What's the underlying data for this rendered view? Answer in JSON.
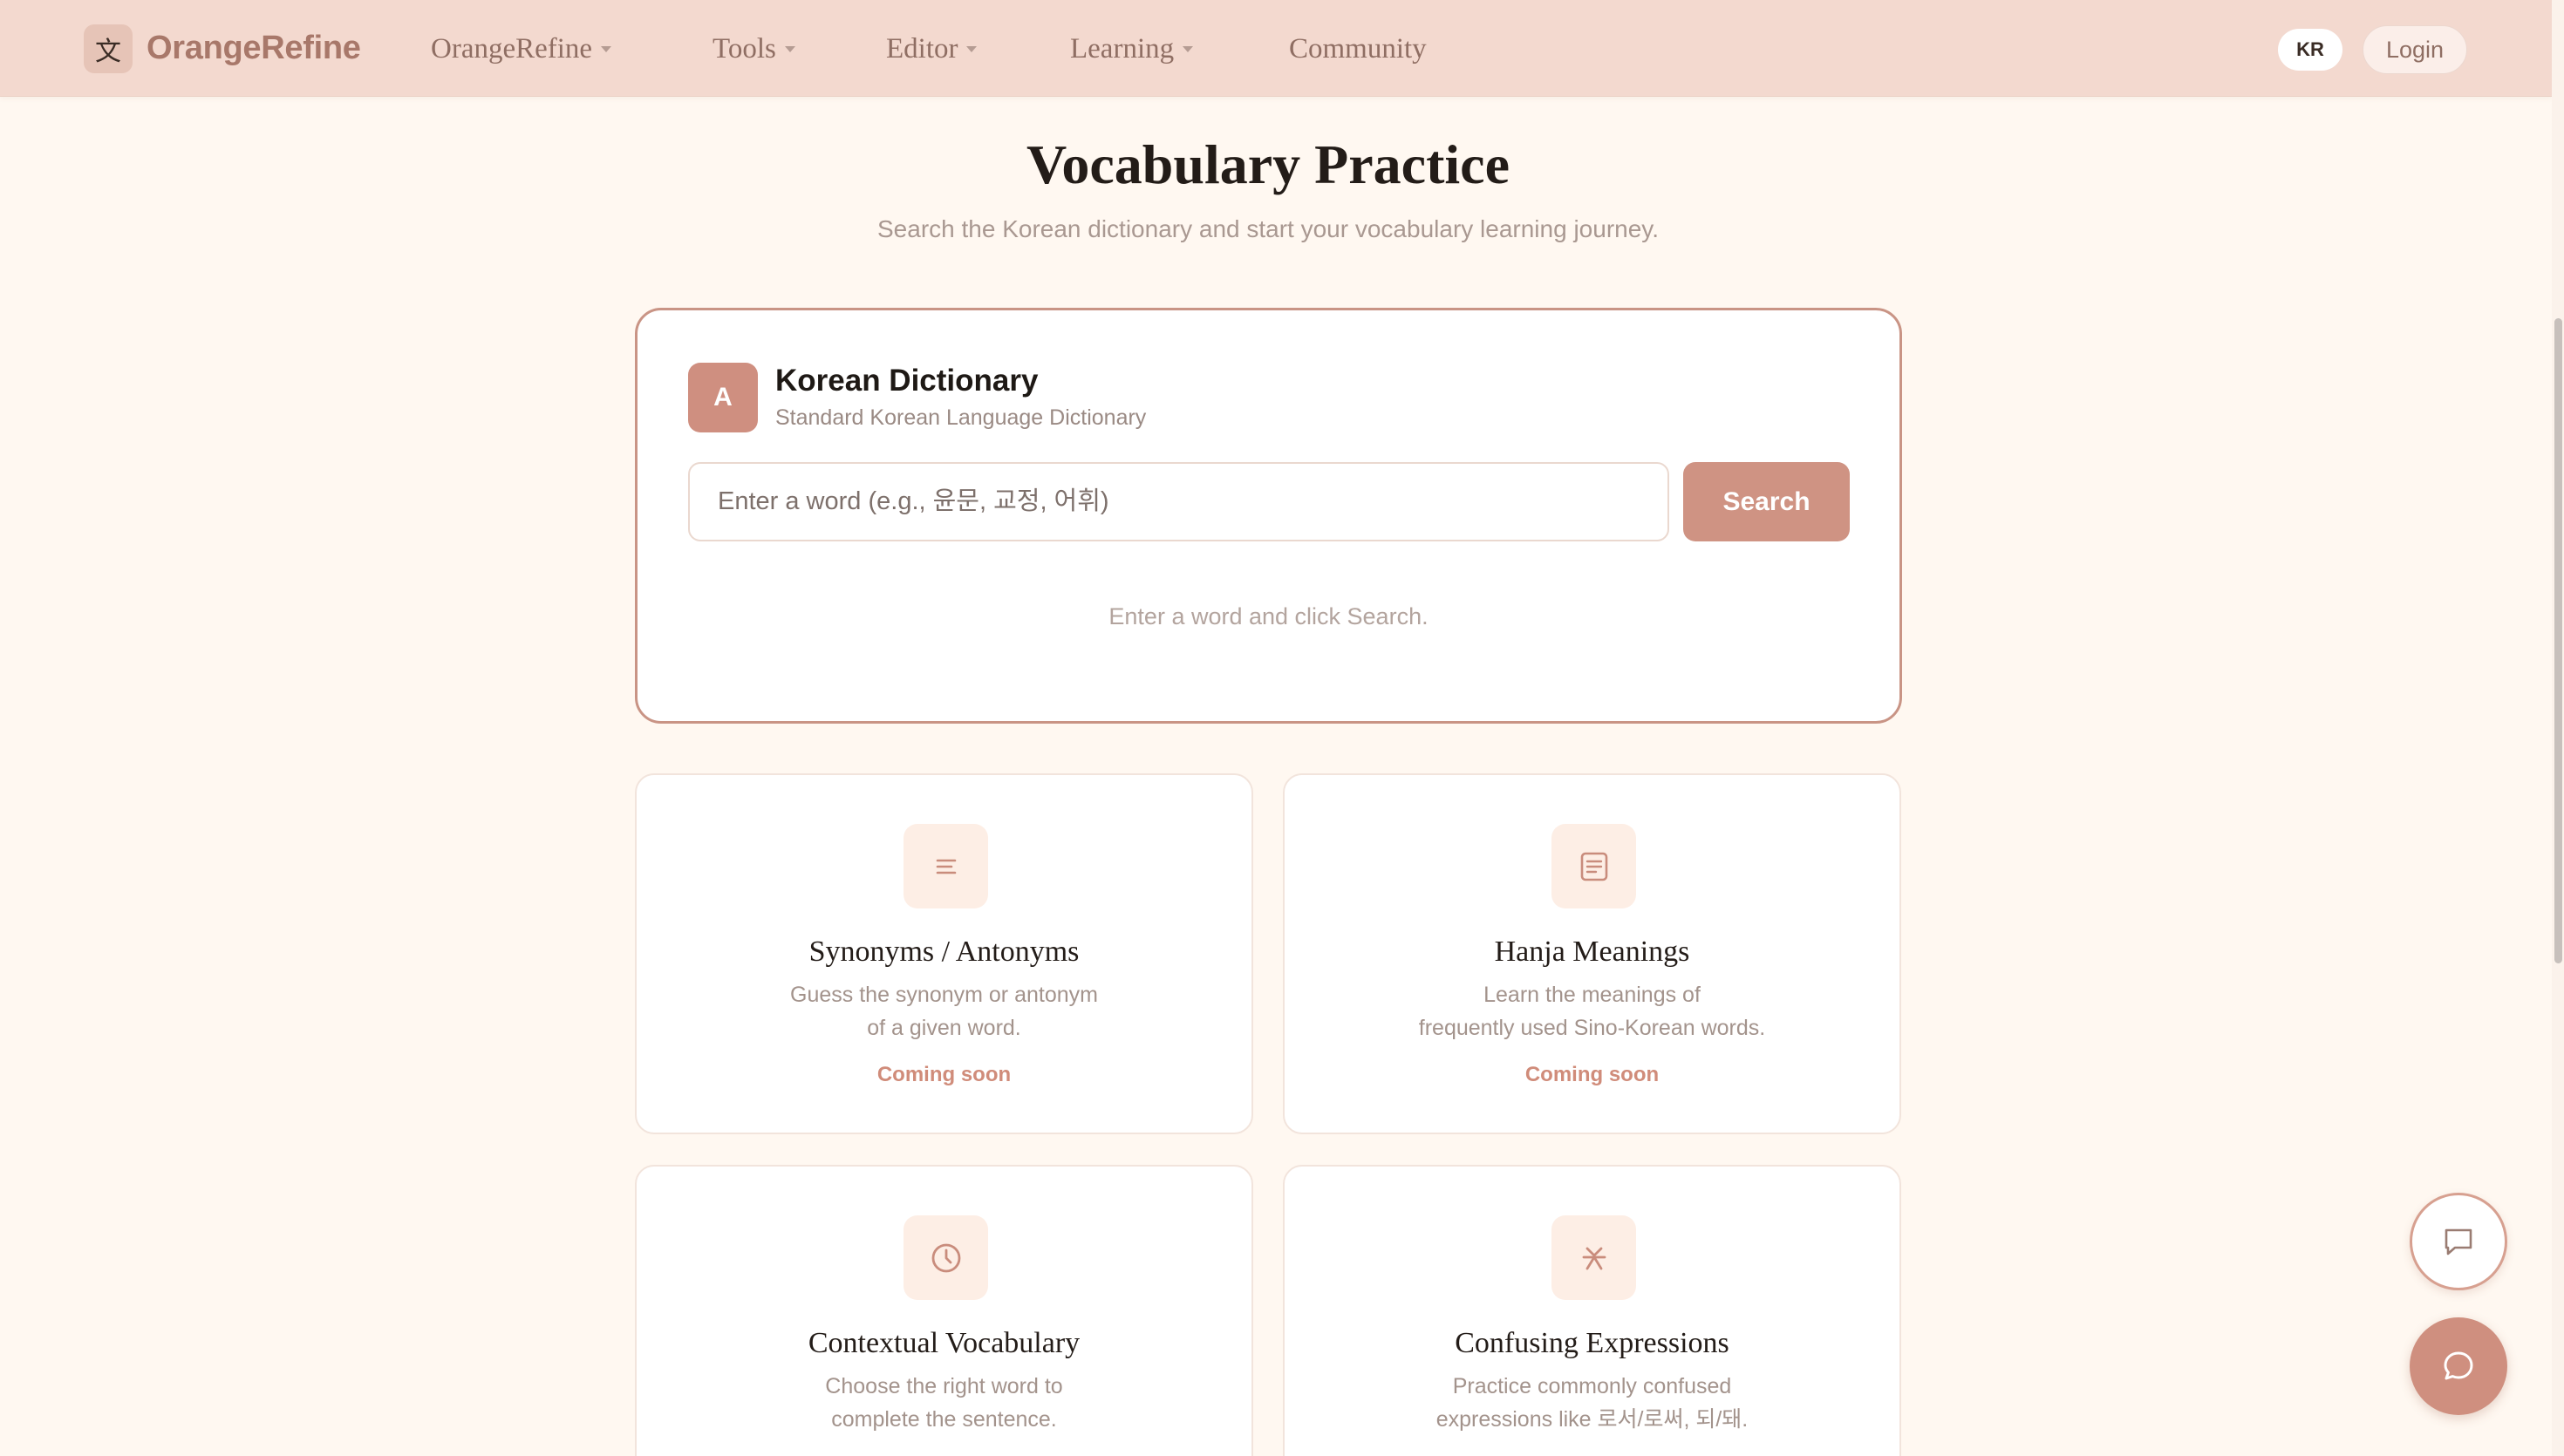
{
  "header": {
    "logo_glyph": "文",
    "logo_text": "OrangeRefine",
    "nav": [
      {
        "label": "OrangeRefine",
        "has_dropdown": true
      },
      {
        "label": "Tools",
        "has_dropdown": true
      },
      {
        "label": "Editor",
        "has_dropdown": true
      },
      {
        "label": "Learning",
        "has_dropdown": true
      },
      {
        "label": "Community",
        "has_dropdown": false
      }
    ],
    "language": "KR",
    "login_label": "Login"
  },
  "page": {
    "title": "Vocabulary Practice",
    "subtitle": "Search the Korean dictionary and start your vocabulary learning journey."
  },
  "dictionary": {
    "icon_letter": "A",
    "title": "Korean Dictionary",
    "subtitle": "Standard Korean Language Dictionary",
    "search_placeholder": "Enter a word (e.g., 윤문, 교정, 어휘)",
    "search_value": "",
    "search_button": "Search",
    "hint": "Enter a word and click Search."
  },
  "features": [
    {
      "icon": "list-lines-icon",
      "title": "Synonyms / Antonyms",
      "desc_line1": "Guess the synonym or antonym",
      "desc_line2": "of a given word.",
      "status": "Coming soon"
    },
    {
      "icon": "document-icon",
      "title": "Hanja Meanings",
      "desc_line1": "Learn the meanings of",
      "desc_line2": "frequently used Sino-Korean words.",
      "status": "Coming soon"
    },
    {
      "icon": "clock-icon",
      "title": "Contextual Vocabulary",
      "desc_line1": "Choose the right word to",
      "desc_line2": "complete the sentence."
    },
    {
      "icon": "split-arrows-icon",
      "title": "Confusing Expressions",
      "desc_line1": "Practice commonly confused",
      "desc_line2": "expressions like 로서/로써, 되/돼."
    }
  ],
  "colors": {
    "header_bg": "#f3d9cf",
    "page_bg": "#fff8f1",
    "accent": "#cf8f80",
    "card_border": "#c99485"
  },
  "floating_buttons": [
    {
      "icon": "message-square-icon",
      "style": "outline"
    },
    {
      "icon": "chat-bubble-icon",
      "style": "filled"
    }
  ]
}
